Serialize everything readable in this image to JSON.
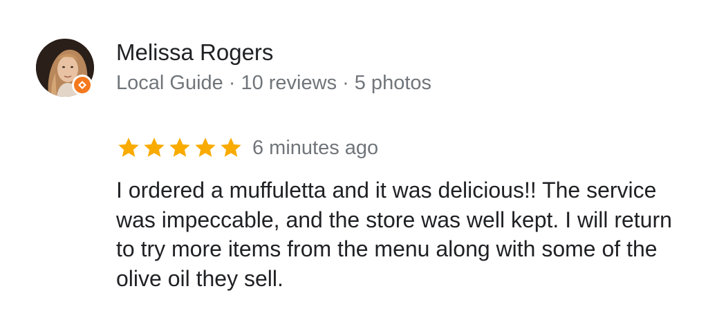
{
  "reviewer": {
    "name": "Melissa Rogers",
    "badge": "Local Guide",
    "separator": "·",
    "reviews": "10 reviews",
    "photos": "5 photos",
    "avatar_icon": "user-photo-avatar",
    "badge_icon": "local-guide-badge-icon"
  },
  "review": {
    "rating": 5,
    "rating_max": 5,
    "time": "6 minutes ago",
    "text": "I ordered a muffuletta and it was delicious!! The service was impeccable, and the store was well kept. I will return to try more items from the menu along with some of the olive oil they sell."
  },
  "colors": {
    "star": "#f9ab00",
    "badge": "#f4791f",
    "name_text": "#202124",
    "meta_text": "#70757a"
  }
}
